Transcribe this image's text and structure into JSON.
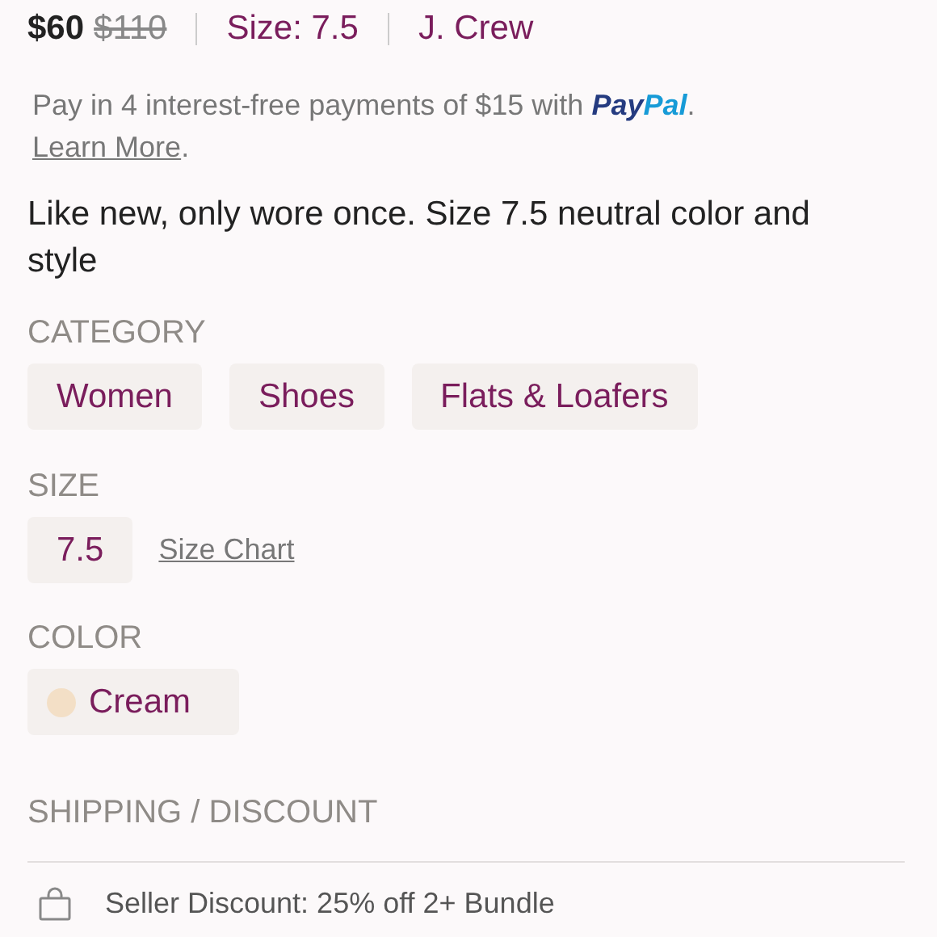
{
  "header": {
    "price": "$60",
    "original_price": "$110",
    "size": "Size: 7.5",
    "brand": "J. Crew"
  },
  "payment": {
    "text": "Pay in 4 interest-free payments of $15 with",
    "brand_first": "Pay",
    "brand_second": "Pal",
    "period": ".",
    "link": "Learn More",
    "link_period": "."
  },
  "description": "Like new, only wore once. Size 7.5 neutral color and style",
  "category": {
    "heading": "CATEGORY",
    "tags": [
      "Women",
      "Shoes",
      "Flats & Loafers"
    ]
  },
  "size": {
    "heading": "SIZE",
    "value": "7.5",
    "link": "Size Chart"
  },
  "color": {
    "heading": "COLOR",
    "items": [
      {
        "label": "Cream",
        "color": "#f3dfc6"
      }
    ]
  },
  "shipping": {
    "heading": "SHIPPING / DISCOUNT",
    "rows": [
      {
        "text": "Seller Discount: 25% off 2+ Bundle"
      }
    ]
  }
}
